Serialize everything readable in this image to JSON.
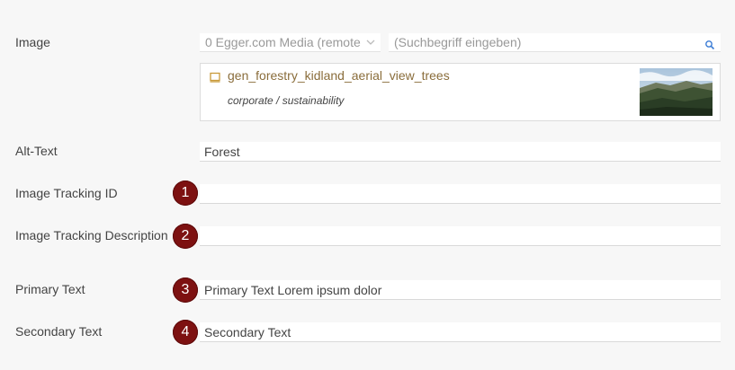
{
  "form": {
    "image": {
      "label": "Image",
      "source_select": "0 Egger.com Media (remote",
      "search_placeholder": "(Suchbegriff eingeben)",
      "asset_name": "gen_forestry_kidland_aerial_view_trees",
      "asset_path": "corporate / sustainability",
      "icons": {
        "select": "chevron-down-icon",
        "search": "search-icon",
        "asset": "image-file-icon"
      }
    },
    "alt_text": {
      "label": "Alt-Text",
      "value": "Forest"
    },
    "tracking_id": {
      "label": "Image Tracking ID",
      "value": "",
      "badge": "1"
    },
    "tracking_description": {
      "label": "Image Tracking Description",
      "value": "",
      "badge": "2"
    },
    "primary_text": {
      "label": "Primary Text",
      "value": "Primary Text Lorem ipsum dolor",
      "badge": "3"
    },
    "secondary_text": {
      "label": "Secondary Text",
      "value": "Secondary Text",
      "badge": "4"
    }
  },
  "colors": {
    "badge": "#7d1111",
    "asset_link": "#8a6d3b",
    "background": "#f7f7f7"
  }
}
